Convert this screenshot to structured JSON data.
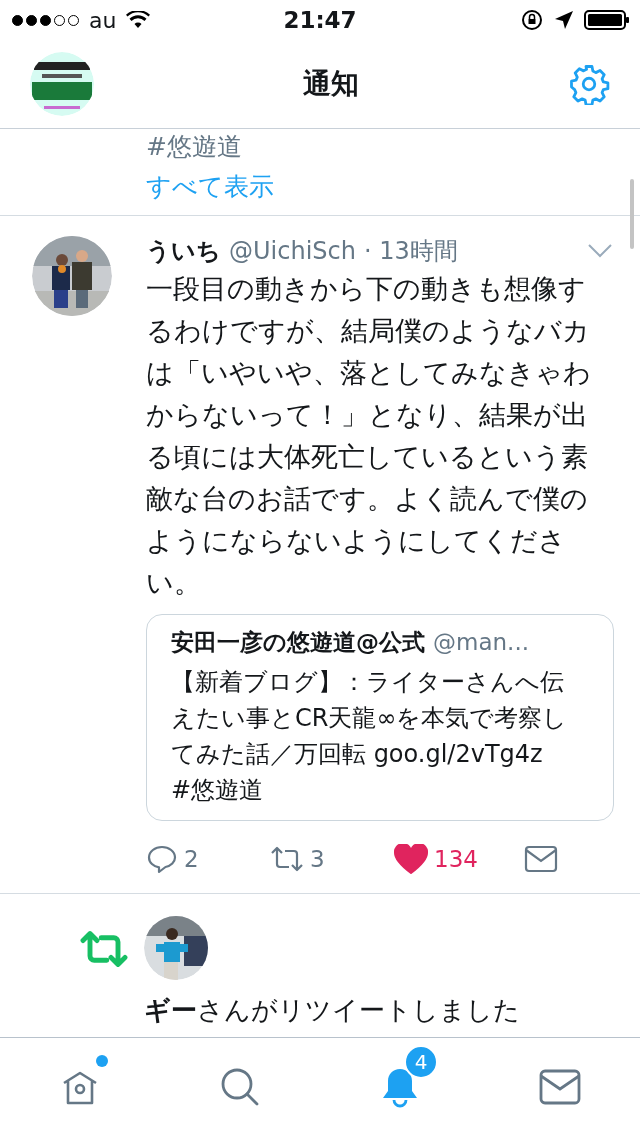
{
  "status_bar": {
    "carrier": "au",
    "time": "21:47"
  },
  "header": {
    "title": "通知"
  },
  "previous_item": {
    "hashtag": "#悠遊道",
    "show_all": "すべて表示"
  },
  "tweet": {
    "name": "ういち",
    "handle": "@UichiSch",
    "time": "· 13時間",
    "text": "一段目の動きから下の動きも想像するわけですが、結局僕のようなバカは「いやいや、落としてみなきゃわからないって！」となり、結果が出る頃には大体死亡しているという素敵な台のお話です。よく読んで僕のようにならないようにしてください。",
    "quote": {
      "name": "安田一彦の悠遊道@公式",
      "handle": "@man...",
      "text": "【新着ブログ】：ライターさんへ伝えたい事とCR天龍∞を本気で考察してみた話／万回転 goo.gl/2vTg4z　#悠遊道"
    },
    "replies": "2",
    "retweets": "3",
    "likes": "134",
    "liked": true
  },
  "retweet_notice": {
    "text": "**ギー**さんがリツイートしました"
  },
  "tab_bar": [
    {
      "kind": "home",
      "selected": false,
      "dot": true
    },
    {
      "kind": "search",
      "selected": false
    },
    {
      "kind": "notifications",
      "selected": true,
      "badge": "4"
    },
    {
      "kind": "messages",
      "selected": false
    }
  ]
}
